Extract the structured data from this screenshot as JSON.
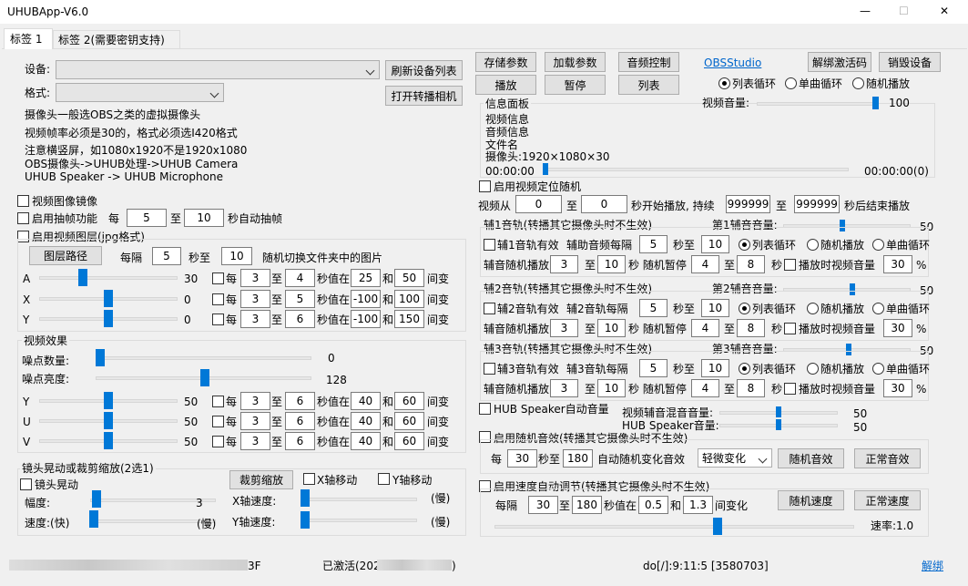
{
  "window": {
    "title": "UHUBApp-V6.0",
    "min": "—",
    "max": "☐",
    "close": "✕"
  },
  "tabs": [
    "标签 1",
    "标签 2(需要密钥支持)"
  ],
  "left": {
    "device_label": "设备:",
    "format_label": "格式:",
    "refresh_btn": "刷新设备列表",
    "open_btn": "打开转播相机",
    "notes": [
      "摄像头一般选OBS之类的虚拟摄像头",
      "视频帧率必须是30的，格式必须选I420格式",
      "注意横竖屏，如1080x1920不是1920x1080",
      "OBS摄像头->UHUB处理->UHUB Camera",
      "UHUB Speaker -> UHUB Microphone"
    ],
    "mirror": "视频图像镜像",
    "frame": {
      "label": "启用抽帧功能",
      "each": "每",
      "from": "5",
      "to_label": "至",
      "to": "10",
      "suffix": "秒自动抽帧"
    },
    "layer": {
      "label": "启用视频图层(jpg格式)",
      "path_btn": "图层路径",
      "every": "每隔",
      "v1": "5",
      "sec_to": "秒至",
      "v2": "10",
      "suffix": "随机切换文件夹中的图片",
      "rows": [
        {
          "axis": "A",
          "val": "30",
          "each": "每",
          "a": "3",
          "to": "至",
          "b": "4",
          "mid": "秒值在",
          "c": "25",
          "and": "和",
          "d": "50",
          "tail": "间变"
        },
        {
          "axis": "X",
          "val": "0",
          "each": "每",
          "a": "3",
          "to": "至",
          "b": "5",
          "mid": "秒值在",
          "c": "-100",
          "and": "和",
          "d": "100",
          "tail": "间变"
        },
        {
          "axis": "Y",
          "val": "0",
          "each": "每",
          "a": "3",
          "to": "至",
          "b": "6",
          "mid": "秒值在",
          "c": "-100",
          "and": "和",
          "d": "150",
          "tail": "间变"
        }
      ]
    },
    "effect": {
      "title": "视频效果",
      "noise_count_label": "噪点数量:",
      "noise_count": "0",
      "noise_bright_label": "噪点亮度:",
      "noise_bright": "128",
      "rows": [
        {
          "axis": "Y",
          "val": "50",
          "each": "每",
          "a": "3",
          "to": "至",
          "b": "6",
          "mid": "秒值在",
          "c": "40",
          "and": "和",
          "d": "60",
          "tail": "间变"
        },
        {
          "axis": "U",
          "val": "50",
          "each": "每",
          "a": "3",
          "to": "至",
          "b": "6",
          "mid": "秒值在",
          "c": "40",
          "and": "和",
          "d": "60",
          "tail": "间变"
        },
        {
          "axis": "V",
          "val": "50",
          "each": "每",
          "a": "3",
          "to": "至",
          "b": "6",
          "mid": "秒值在",
          "c": "40",
          "and": "和",
          "d": "60",
          "tail": "间变"
        }
      ]
    },
    "shake": {
      "title": "镜头晃动或裁剪缩放(2选1)",
      "shake_cb": "镜头晃动",
      "crop_btn": "裁剪缩放",
      "xmove": "X轴移动",
      "ymove": "Y轴移动",
      "amp_label": "幅度:",
      "amp": "3",
      "speed_label": "速度:(快)",
      "speed_tail": "(慢)",
      "xspeed": "X轴速度:",
      "xslow": "(慢)",
      "yspeed": "Y轴速度:",
      "yslow": "(慢)"
    }
  },
  "right": {
    "buttons": [
      "存储参数",
      "加载参数",
      "音频控制",
      "播放",
      "暂停",
      "列表"
    ],
    "obs": "OBSStudio",
    "unbind": "解绑激活码",
    "destroy": "销毁设备",
    "playmode": [
      "列表循环",
      "单曲循环",
      "随机播放"
    ],
    "info_title": "信息面板",
    "info": [
      "视频信息",
      "音频信息",
      "文件名",
      "摄像头:1920×1080×30"
    ],
    "volume_label": "视频音量:",
    "volume": "100",
    "t_start": "00:00:00",
    "t_end": "00:00:00(0)",
    "locate": {
      "label": "启用视频定位随机",
      "from_label": "视频从",
      "from": "0",
      "to_label": "至",
      "to": "0",
      "mid": "秒开始播放, 持续",
      "a": "999999",
      "to2": "至",
      "b": "999999",
      "tail": "秒后结束播放"
    },
    "tracks": [
      {
        "title": "辅1音轨(转播其它摄像头时不生效)",
        "vol_label": "第1辅音音量:",
        "vol": "50",
        "en": "辅1音轨有效",
        "gap_label": "辅助音频每隔",
        "g1": "5",
        "g_to": "秒至",
        "g2": "10",
        "modes": [
          "列表循环",
          "随机播放",
          "单曲循环"
        ],
        "rnd_label": "辅音随机播放",
        "r1": "3",
        "r_to": "至",
        "r2": "10",
        "pause_label": "秒 随机暂停",
        "p1": "4",
        "p_to": "至",
        "p2": "8",
        "sec": "秒",
        "vv_label": "播放时视频音量",
        "vv": "30",
        "pct": "%"
      },
      {
        "title": "辅2音轨(转播其它摄像头时不生效)",
        "vol_label": "第2辅音音量:",
        "vol": "50",
        "en": "辅2音轨有效",
        "gap_label": "辅2音轨每隔",
        "g1": "5",
        "g_to": "秒至",
        "g2": "10",
        "modes": [
          "列表循环",
          "随机播放",
          "单曲循环"
        ],
        "rnd_label": "辅音随机播放",
        "r1": "3",
        "r_to": "至",
        "r2": "10",
        "pause_label": "秒 随机暂停",
        "p1": "4",
        "p_to": "至",
        "p2": "8",
        "sec": "秒",
        "vv_label": "播放时视频音量",
        "vv": "30",
        "pct": "%"
      },
      {
        "title": "辅3音轨(转播其它摄像头时不生效)",
        "vol_label": "第3辅音音量:",
        "vol": "50",
        "en": "辅3音轨有效",
        "gap_label": "辅3音轨每隔",
        "g1": "5",
        "g_to": "秒至",
        "g2": "10",
        "modes": [
          "列表循环",
          "随机播放",
          "单曲循环"
        ],
        "rnd_label": "辅音随机播放",
        "r1": "3",
        "r_to": "至",
        "r2": "10",
        "pause_label": "秒 随机暂停",
        "p1": "4",
        "p_to": "至",
        "p2": "8",
        "sec": "秒",
        "vv_label": "播放时视频音量",
        "vv": "30",
        "pct": "%"
      }
    ],
    "hub": {
      "label": "HUB Speaker自动音量",
      "mix_label": "视频辅音混音音量:",
      "mix": "50",
      "spk_label": "HUB Speaker音量:",
      "spk": "50"
    },
    "rndfx": {
      "label": "启用随机音效(转播其它摄像头时不生效)",
      "each": "每",
      "a": "30",
      "to": "秒至",
      "b": "180",
      "mid": "自动随机变化音效",
      "select": "轻微变化",
      "btn1": "随机音效",
      "btn2": "正常音效"
    },
    "speed": {
      "label": "启用速度自动调节(转播其它摄像头时不生效)",
      "every": "每隔",
      "a": "30",
      "to": "至",
      "b": "180",
      "mid": "秒值在",
      "c": "0.5",
      "and": "和",
      "d": "1.3",
      "tail": "间变化",
      "btn1": "随机速度",
      "btn2": "正常速度",
      "rate": "速率:1.0"
    }
  },
  "status": {
    "activated": "已激活(2024",
    "close_paren": ")",
    "suffix": "3F",
    "info": "do[/]:9:11:5 [3580703]",
    "unbind": "解绑"
  }
}
